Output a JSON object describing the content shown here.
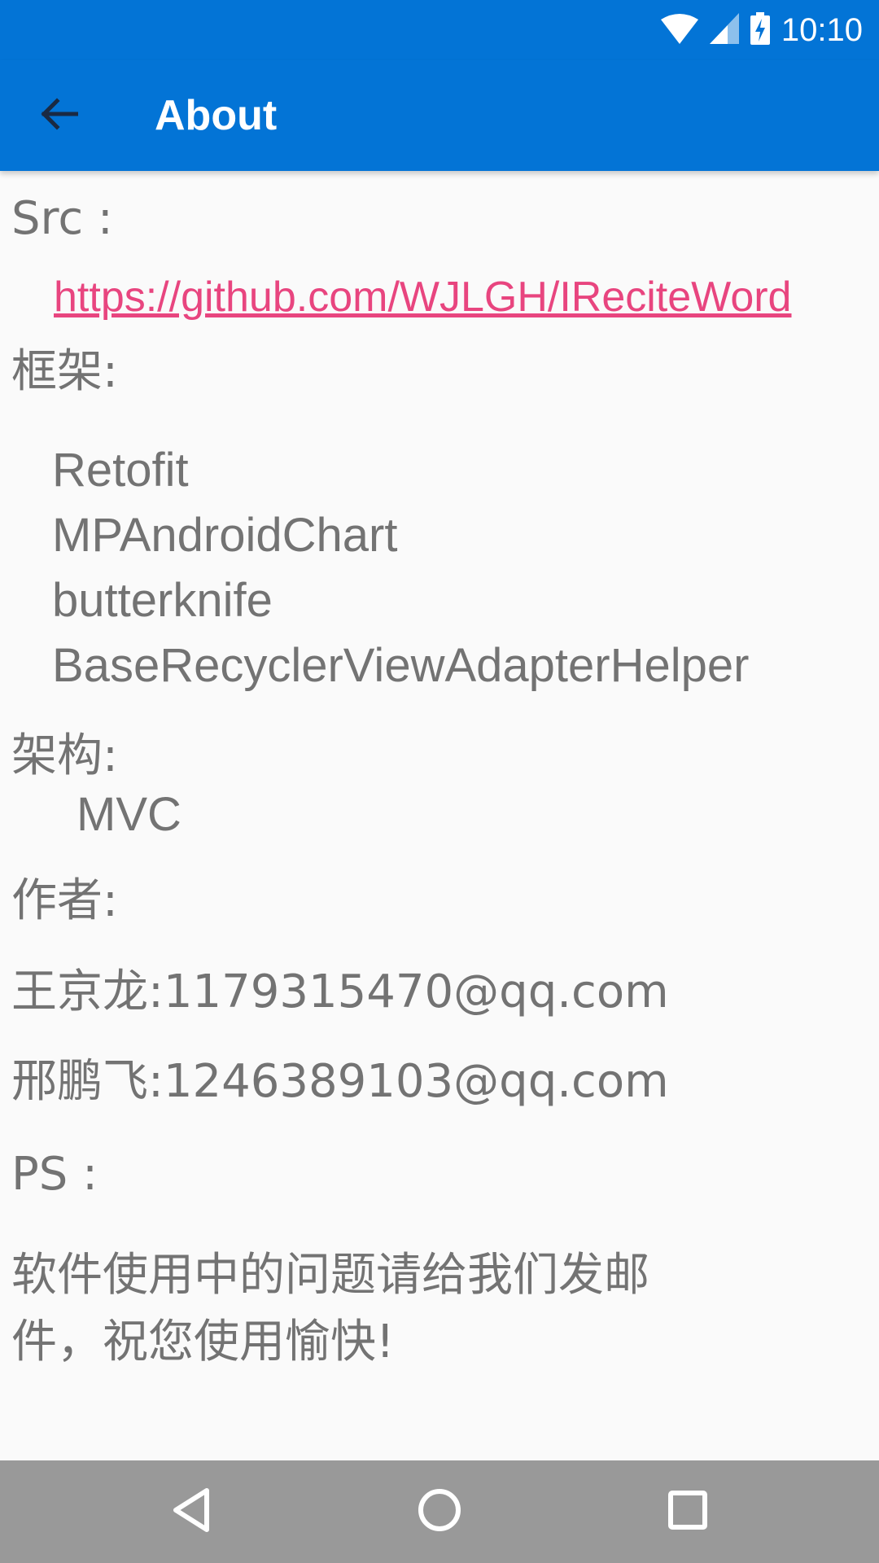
{
  "status_bar": {
    "time": "10:10",
    "icons": [
      "wifi-icon",
      "cell-signal-icon",
      "battery-charging-icon"
    ]
  },
  "app_bar": {
    "title": "About",
    "back_icon": "arrow-left-icon",
    "color": "#0374d6"
  },
  "content": {
    "src_label": "Src :",
    "src_link": "https://github.com/WJLGH/IReciteWord",
    "framework_label": "框架:",
    "frameworks": [
      "Retofit",
      "MPAndroidChart",
      "butterknife",
      "BaseRecyclerViewAdapterHelper"
    ],
    "architecture_label": "架构:",
    "architecture_value": "MVC",
    "author_label": "作者:",
    "authors": [
      "王京龙:1179315470@qq.com",
      "邢鹏飞:1246389103@qq.com"
    ],
    "ps_label": "PS :",
    "ps_text_line1": "软件使用中的问题请给我们发邮",
    "ps_text_line2": "件，祝您使用愉快!",
    "text_color": "#737373",
    "link_color": "#e8457f"
  },
  "nav_bar": {
    "back_icon": "triangle-back-icon",
    "home_icon": "circle-home-icon",
    "recents_icon": "square-recents-icon",
    "color": "#999999"
  }
}
